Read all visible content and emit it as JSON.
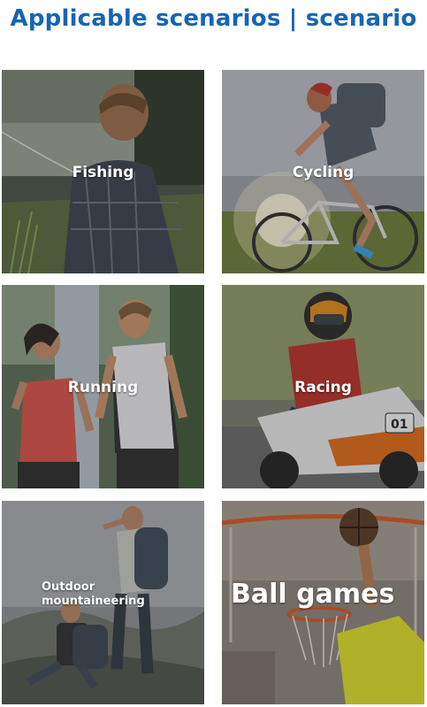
{
  "header": {
    "title": "Applicable scenarios | scenario"
  },
  "tiles": [
    {
      "label": "Fishing",
      "icon": "fishing-scene-image"
    },
    {
      "label": "Cycling",
      "icon": "cycling-scene-image"
    },
    {
      "label": "Running",
      "icon": "running-scene-image"
    },
    {
      "label": "Racing",
      "icon": "racing-scene-image"
    },
    {
      "label": "Outdoor mountaineering",
      "icon": "mountaineering-scene-image"
    },
    {
      "label": "Ball games",
      "icon": "ball-games-scene-image"
    }
  ],
  "colors": {
    "title": "#1565b7",
    "label": "#ffffff"
  }
}
